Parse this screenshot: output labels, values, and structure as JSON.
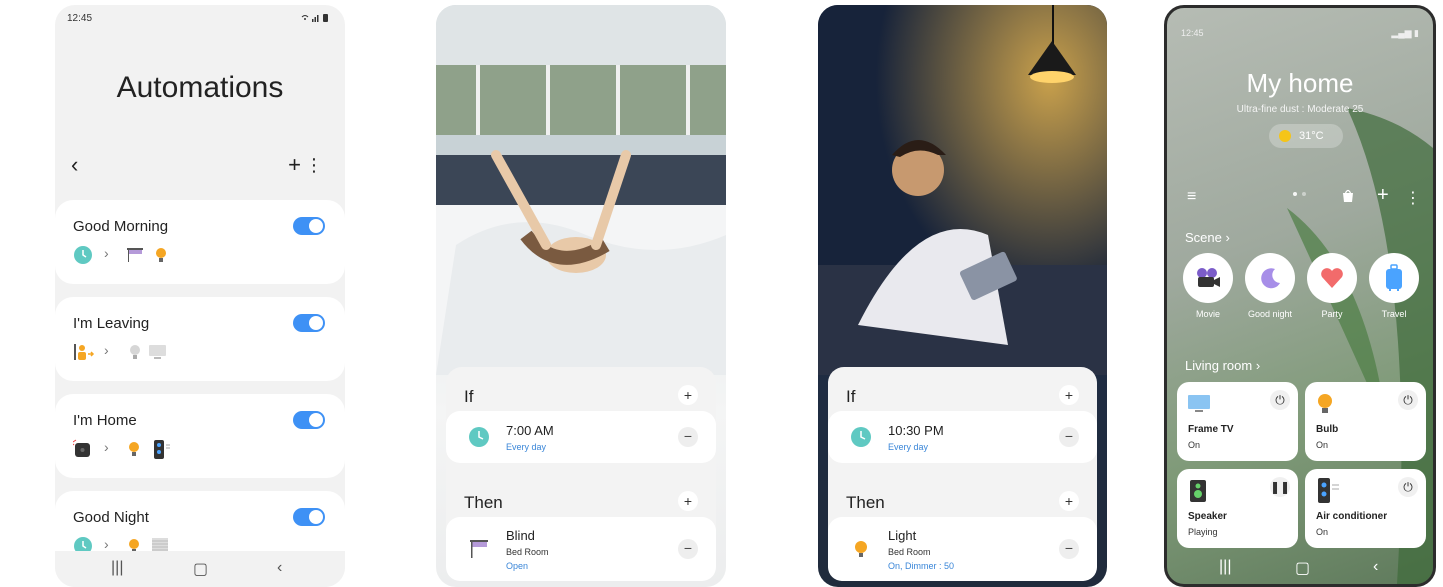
{
  "automations": {
    "status_time": "12:45",
    "status_icons": "wifi signal battery",
    "title": "Automations",
    "nav": {
      "back": "back-icon",
      "add": "plus-icon",
      "more": "more-vert-icon"
    },
    "items": [
      {
        "name": "Good Morning",
        "enabled": true,
        "icons": [
          "clock-icon",
          "blind-icon",
          "bulb-icon"
        ]
      },
      {
        "name": "I'm Leaving",
        "enabled": true,
        "icons": [
          "person-leaving-icon",
          "bulb-off-icon",
          "tv-icon"
        ]
      },
      {
        "name": "I'm Home",
        "enabled": true,
        "icons": [
          "sensor-icon",
          "bulb-icon",
          "air-conditioner-icon"
        ]
      },
      {
        "name": "Good Night",
        "enabled": true,
        "icons": [
          "clock-icon",
          "bulb-icon",
          "blind-closed-icon"
        ]
      }
    ]
  },
  "morning": {
    "if_label": "If",
    "then_label": "Then",
    "condition": {
      "time": "7:00 AM",
      "repeat": "Every day"
    },
    "action": {
      "device": "Blind",
      "room": "Bed Room",
      "state": "Open"
    }
  },
  "night": {
    "if_label": "If",
    "then_label": "Then",
    "condition": {
      "time": "10:30 PM",
      "repeat": "Every day"
    },
    "action": {
      "device": "Light",
      "room": "Bed Room",
      "state": "On, Dimmer : 50"
    }
  },
  "home": {
    "status_time": "12:45",
    "title": "My home",
    "dust": "Ultra-fine dust : Moderate 25",
    "temperature": "31°C",
    "scene_label": "Scene",
    "scenes": [
      {
        "label": "Movie",
        "icon": "camera-icon"
      },
      {
        "label": "Good night",
        "icon": "moon-icon"
      },
      {
        "label": "Party",
        "icon": "heart-icon"
      },
      {
        "label": "Travel",
        "icon": "suitcase-icon"
      }
    ],
    "room_label": "Living room",
    "devices": [
      {
        "name": "Frame TV",
        "state": "On",
        "icon": "tv-icon",
        "control": "power-icon"
      },
      {
        "name": "Bulb",
        "state": "On",
        "icon": "bulb-icon",
        "control": "power-icon"
      },
      {
        "name": "Speaker",
        "state": "Playing",
        "icon": "speaker-icon",
        "control": "pause-icon"
      },
      {
        "name": "Air conditioner",
        "state": "On",
        "icon": "air-conditioner-icon",
        "control": "power-icon"
      }
    ]
  },
  "colors": {
    "accent": "#3e91f5",
    "teal": "#5fc9c2",
    "amber": "#f5a623",
    "link": "#3a86d8"
  }
}
